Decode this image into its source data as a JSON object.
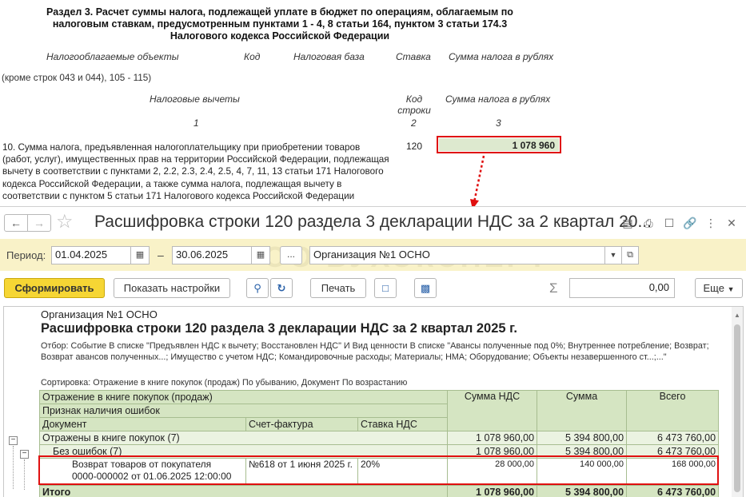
{
  "declaration": {
    "title": "Раздел 3. Расчет суммы налога, подлежащей уплате в бюджет по операциям, облагаемым по налоговым ставкам, предусмотренным пунктами 1 - 4, 8 статьи 164, пунктом 3 статьи 174.3 Налогового кодекса Российской Федерации",
    "headers1": {
      "objects": "Налогооблагаемые объекты",
      "code": "Код",
      "base": "Налоговая база",
      "rate": "Ставка",
      "sum": "Сумма налога в рублях"
    },
    "cut_line": "(кроме строк 043 и 044), 105 - 115)",
    "headers2": {
      "deductions": "Налоговые вычеты",
      "code": "Код строки",
      "sum": "Сумма налога в рублях"
    },
    "colnums": {
      "c1": "1",
      "c2": "2",
      "c3": "3"
    },
    "line10_text": "10. Сумма налога, предъявленная налогоплательщику при приобретении товаров (работ, услуг), имущественных прав на территории Российской Федерации, подлежащая вычету в соответствии с пунктами 2, 2.2, 2.3, 2.4, 2.5, 4, 7, 11, 13 статьи 171 Налогового кодекса Российской Федерации, а также сумма налога, подлежащая вычету в соответствии с пунктом 5 статьи 171 Налогового кодекса Российской Федерации",
    "line10_code": "120",
    "line10_sum": "1 078 960"
  },
  "window": {
    "title": "Расшифровка строки 120 раздела 3 декларации НДС за 2 квартал 20...",
    "watermark": "ОО БУХЭКСПЕРТ"
  },
  "period": {
    "label": "Период:",
    "from": "01.04.2025",
    "dash": "–",
    "to": "30.06.2025",
    "dots": "...",
    "organization": "Организация №1 ОСНО"
  },
  "commands": {
    "generate": "Сформировать",
    "show_settings": "Показать настройки",
    "print": "Печать",
    "sum_value": "0,00",
    "more": "Еще",
    "sigma": "Σ"
  },
  "report": {
    "org": "Организация №1 ОСНО",
    "title": "Расшифровка строки 120 раздела 3 декларации НДС за 2 квартал 2025 г.",
    "filter": "Отбор: Событие В списке \"Предъявлен НДС к вычету; Восстановлен НДС\" И Вид ценности В списке \"Авансы полученные под 0%; Внутреннее потребление; Возврат; Возврат авансов полученных...; Имущество с учетом НДС; Командировочные расходы; Материалы; НМА; Оборудование; Объекты незавершенного ст...;...\"",
    "sort": "Сортировка: Отражение в книге покупок (продаж) По убыванию, Документ По возрастанию",
    "headers": {
      "group1": "Отражение в книге покупок (продаж)",
      "group2": "Признак наличия ошибок",
      "document": "Документ",
      "invoice": "Счет-фактура",
      "rate": "Ставка НДС",
      "vat": "Сумма НДС",
      "sum": "Сумма",
      "total": "Всего"
    },
    "rows": [
      {
        "label": "Отражены в книге покупок (7)",
        "vat": "1 078 960,00",
        "sum": "5 394 800,00",
        "total": "6 473 760,00"
      },
      {
        "label": "Без ошибок (7)",
        "vat": "1 078 960,00",
        "sum": "5 394 800,00",
        "total": "6 473 760,00"
      }
    ],
    "detail": {
      "doc_line1": "Возврат товаров от покупателя",
      "doc_line2": "0000-000002 от 01.06.2025 12:00:00",
      "invoice": "№618 от 1 июня 2025 г.",
      "rate": "20%",
      "vat": "28 000,00",
      "sum": "140 000,00",
      "total": "168 000,00"
    },
    "totals": {
      "label": "Итого",
      "vat": "1 078 960,00",
      "sum": "5 394 800,00",
      "total": "6 473 760,00"
    }
  }
}
